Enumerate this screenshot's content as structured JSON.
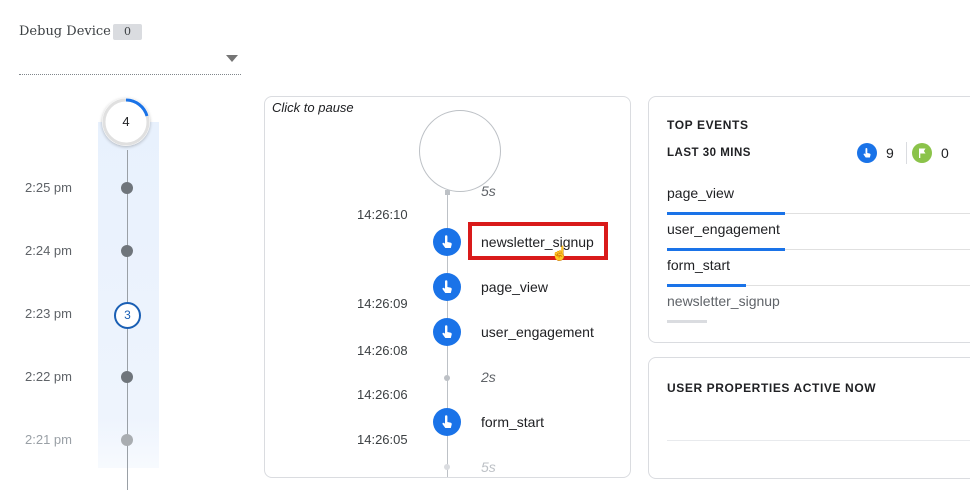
{
  "debug_device": {
    "label": "Debug Device",
    "count": "0",
    "selected_value": ""
  },
  "minutes": {
    "total": "4",
    "items": [
      {
        "time": "2:25 pm",
        "count": ""
      },
      {
        "time": "2:24 pm",
        "count": ""
      },
      {
        "time": "2:23 pm",
        "count": "3"
      },
      {
        "time": "2:22 pm",
        "count": ""
      },
      {
        "time": "2:21 pm",
        "count": ""
      }
    ]
  },
  "stream": {
    "pause_label": "Click to pause",
    "gaps": [
      "5s",
      "2s",
      "5s"
    ],
    "timestamps": [
      "14:26:10",
      "14:26:09",
      "14:26:08",
      "14:26:06",
      "14:26:05"
    ],
    "events": [
      {
        "name": "newsletter_signup",
        "icon": "touch-icon"
      },
      {
        "name": "page_view",
        "icon": "touch-icon"
      },
      {
        "name": "user_engagement",
        "icon": "touch-icon"
      },
      {
        "name": "form_start",
        "icon": "touch-icon"
      }
    ],
    "highlight_color": "#d91a1a"
  },
  "top_events": {
    "title": "TOP EVENTS",
    "subtitle": "LAST 30 MINS",
    "event_count": "9",
    "conversion_count": "0",
    "items": [
      "page_view",
      "user_engagement",
      "form_start",
      "newsletter_signup"
    ]
  },
  "user_properties": {
    "title": "USER PROPERTIES ACTIVE NOW"
  },
  "colors": {
    "accent": "#1a73e8",
    "conversion": "#8bc34a",
    "highlight": "#d91a1a"
  }
}
